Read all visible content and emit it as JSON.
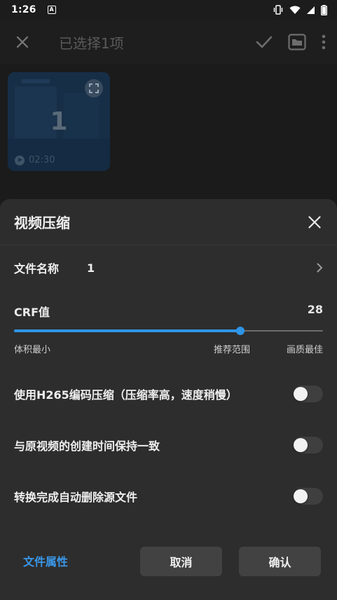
{
  "status_bar": {
    "time": "1:26",
    "notification_letter": "A"
  },
  "app_bar": {
    "title": "已选择1项"
  },
  "thumbnail": {
    "number": "1",
    "duration": "02:30"
  },
  "sheet": {
    "title": "视频压缩",
    "file_name_label": "文件名称",
    "file_name_value": "1",
    "crf_label": "CRF值",
    "crf_value": "28",
    "slider_fraction": 0.733,
    "slider_left_label": "体积最小",
    "slider_mid_label": "推荐范围",
    "slider_right_label": "画质最佳",
    "toggles": [
      {
        "label": "使用H265编码压缩（压缩率高，速度稍慢）",
        "on": false
      },
      {
        "label": "与原视频的创建时间保持一致",
        "on": false
      },
      {
        "label": "转换完成自动删除源文件",
        "on": false
      }
    ],
    "file_props_link": "文件属性",
    "cancel_label": "取消",
    "confirm_label": "确认"
  },
  "colors": {
    "accent": "#2f95e6",
    "sheet_bg": "#2d2d2d",
    "link": "#3a97e8"
  }
}
